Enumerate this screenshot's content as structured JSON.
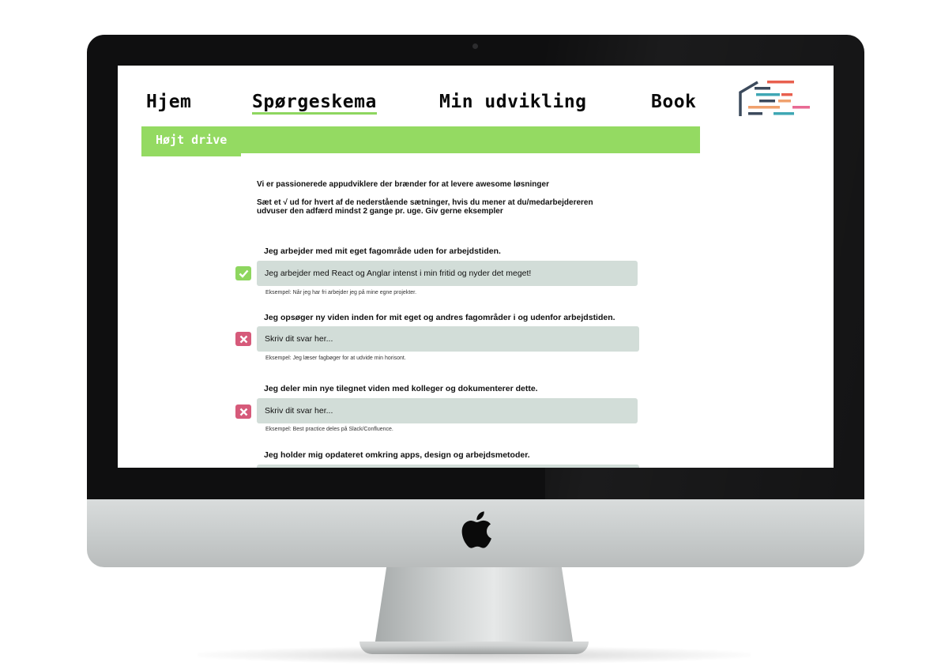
{
  "nav": {
    "items": [
      {
        "label": "Hjem"
      },
      {
        "label": "Spørgeskema",
        "active": true
      },
      {
        "label": "Min udvikling"
      },
      {
        "label": "Book"
      }
    ]
  },
  "banner": {
    "label": "Højt drive"
  },
  "intro": {
    "line1": "Vi er passionerede appudviklere der brænder for at levere awesome løsninger",
    "line2a": "Sæt et √ ud for hvert af de nederstående sætninger, hvis du mener at du/medarbejdereren",
    "line2b": "udvuser den adfærd mindst 2 gange pr. uge. Giv gerne eksempler"
  },
  "questions": [
    {
      "title": "Jeg arbejder med mit eget fagområde uden for arbejdstiden.",
      "answer": "Jeg arbejder med React og Anglar intenst i min fritid og nyder det meget!",
      "placeholder": "",
      "example": "Eksempel: Når jeg har fri arbejder jeg på mine egne projekter.",
      "status": "checked"
    },
    {
      "title": "Jeg opsøger ny viden inden for mit  eget og andres fagområder i og udenfor arbejdstiden.",
      "answer": "",
      "placeholder": "Skriv dit svar her...",
      "example": "Eksempel: Jeg læser fagbøger for at udvide min horisont.",
      "status": "unchecked"
    },
    {
      "title": "Jeg deler min nye tilegnet viden med kolleger og dokumenterer dette.",
      "answer": "",
      "placeholder": "Skriv dit svar her...",
      "example": "Eksempel: Best practice deles på Slack/Confluence.",
      "status": "unchecked"
    },
    {
      "title": "Jeg holder mig opdateret omkring apps, design og arbejdsmetoder.",
      "answer": "",
      "placeholder": "",
      "example": "",
      "status": "unchecked"
    }
  ],
  "icons": {
    "checked": "checkmark-icon",
    "unchecked": "cross-icon",
    "device": "apple-logo-icon"
  },
  "colors": {
    "accent_green": "#94da62",
    "answer_bg": "#d2ddd8",
    "cross_pink": "#d65a7a"
  }
}
